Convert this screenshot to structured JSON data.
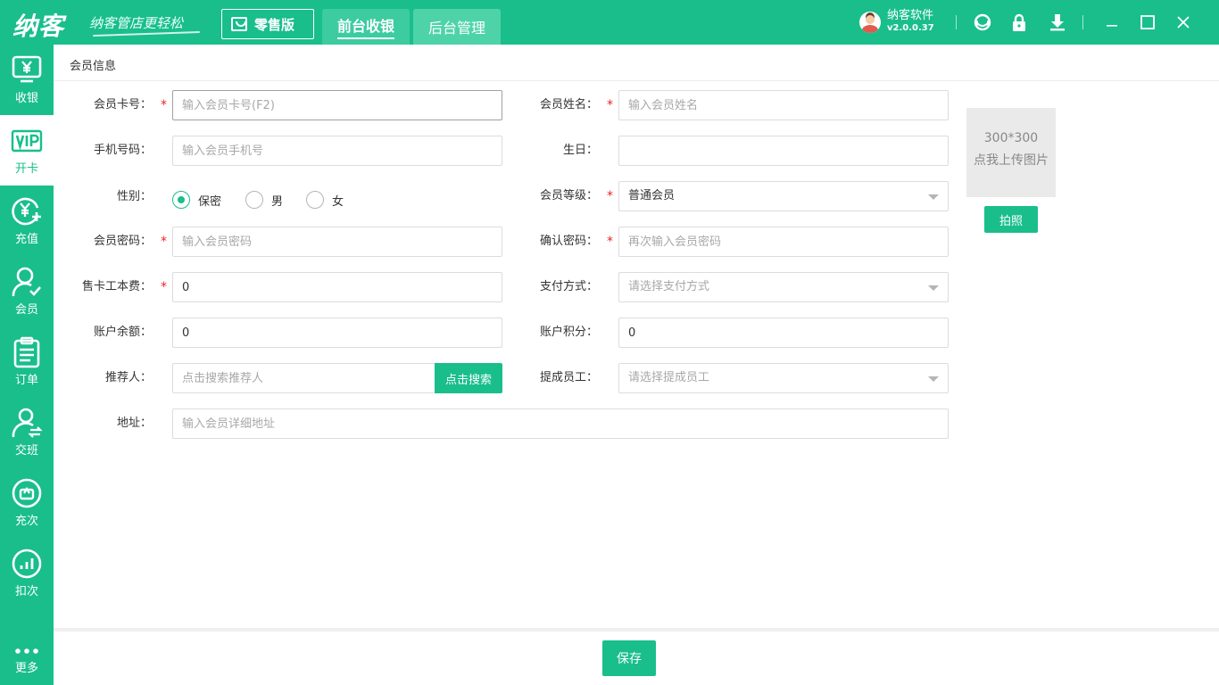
{
  "header": {
    "logo": "纳客",
    "slogan": "纳客管店更轻松",
    "edition": "零售版",
    "tabs": [
      {
        "label": "前台收银",
        "active": true
      },
      {
        "label": "后台管理",
        "active": false
      }
    ],
    "user": {
      "name": "纳客软件",
      "version": "v2.0.0.37"
    },
    "icons": [
      "headset-icon",
      "lock-icon",
      "download-icon"
    ],
    "window_controls": [
      "minimize-icon",
      "maximize-icon",
      "close-icon"
    ]
  },
  "sidebar": {
    "items": [
      {
        "label": "收银",
        "icon": "cashier-icon",
        "active": false
      },
      {
        "label": "开卡",
        "icon": "vip-card-icon",
        "active": true
      },
      {
        "label": "充值",
        "icon": "recharge-icon",
        "active": false
      },
      {
        "label": "会员",
        "icon": "member-icon",
        "active": false
      },
      {
        "label": "订单",
        "icon": "order-icon",
        "active": false
      },
      {
        "label": "交班",
        "icon": "shift-icon",
        "active": false
      },
      {
        "label": "充次",
        "icon": "recharge-times-icon",
        "active": false
      },
      {
        "label": "扣次",
        "icon": "deduct-times-icon",
        "active": false
      },
      {
        "label": "更多",
        "icon": "more-icon",
        "active": false
      }
    ]
  },
  "main": {
    "breadcrumb": "会员信息",
    "form": {
      "card_no": {
        "label": "会员卡号：",
        "placeholder": "输入会员卡号(F2)",
        "value": ""
      },
      "name": {
        "label": "会员姓名：",
        "placeholder": "输入会员姓名",
        "value": ""
      },
      "phone": {
        "label": "手机号码：",
        "placeholder": "输入会员手机号",
        "value": ""
      },
      "birthday": {
        "label": "生日：",
        "placeholder": "",
        "value": ""
      },
      "gender": {
        "label": "性别：",
        "options": [
          "保密",
          "男",
          "女"
        ],
        "selected": "保密"
      },
      "level": {
        "label": "会员等级：",
        "value": "普通会员"
      },
      "password": {
        "label": "会员密码：",
        "placeholder": "输入会员密码"
      },
      "confirm_password": {
        "label": "确认密码：",
        "placeholder": "再次输入会员密码"
      },
      "card_fee": {
        "label": "售卡工本费：",
        "value": "0"
      },
      "payment": {
        "label": "支付方式：",
        "placeholder": "请选择支付方式"
      },
      "balance": {
        "label": "账户余额：",
        "value": "0"
      },
      "points": {
        "label": "账户积分：",
        "value": "0"
      },
      "referrer": {
        "label": "推荐人：",
        "placeholder": "点击搜索推荐人",
        "button": "点击搜索"
      },
      "staff": {
        "label": "提成员工：",
        "placeholder": "请选择提成员工"
      },
      "address": {
        "label": "地址：",
        "placeholder": "输入会员详细地址"
      }
    },
    "photo": {
      "size_text": "300*300",
      "upload_text": "点我上传图片",
      "button": "拍照"
    },
    "save_button": "保存"
  },
  "colors": {
    "brand": "#19be8b",
    "required": "#e22222"
  }
}
